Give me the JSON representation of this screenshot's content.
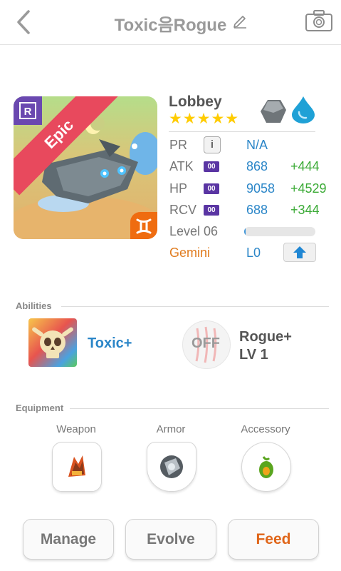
{
  "header": {
    "title": "Toxic음Rogue"
  },
  "monster": {
    "name": "Lobbey",
    "stars": "★★★★★",
    "rarity": "Epic",
    "elements": [
      "rock-element-icon",
      "water-element-icon"
    ],
    "zodiac_icon": "gemini-zodiac-icon"
  },
  "stats": {
    "pr": {
      "label": "PR",
      "value": "N/A"
    },
    "atk": {
      "label": "ATK",
      "badge": "00",
      "value": "868",
      "bonus": "+444"
    },
    "hp": {
      "label": "HP",
      "badge": "00",
      "value": "9058",
      "bonus": "+4529"
    },
    "rcv": {
      "label": "RCV",
      "badge": "00",
      "value": "688",
      "bonus": "+344"
    },
    "level": {
      "label": "Level 06",
      "progress": 0.02
    },
    "zodiac": {
      "label": "Gemini",
      "value": "L0"
    }
  },
  "abilities": {
    "title": "Abilities",
    "first": {
      "name": "Toxic+"
    },
    "second": {
      "status": "OFF",
      "name": "Rogue+",
      "level": "LV 1"
    }
  },
  "equipment": {
    "title": "Equipment",
    "slots": [
      {
        "label": "Weapon"
      },
      {
        "label": "Armor"
      },
      {
        "label": "Accessory"
      }
    ]
  },
  "actions": {
    "manage": "Manage",
    "evolve": "Evolve",
    "feed": "Feed"
  },
  "colors": {
    "accent_blue": "#2b86c8",
    "bonus_green": "#3aaa35",
    "feed_orange": "#e0661a",
    "star": "#ffcc00",
    "epic_red": "#e8495d"
  }
}
